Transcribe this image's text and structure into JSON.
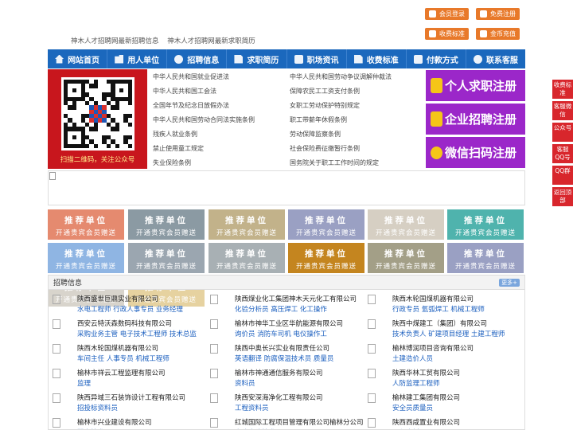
{
  "header": {
    "links": [
      "神木人才招聘网最新招聘信息",
      "神木人才招聘网最新求职简历"
    ],
    "buttons": [
      "会员登录",
      "免费注册",
      "收费标准",
      "金币充值"
    ]
  },
  "nav": {
    "items": [
      {
        "label": "网站首页",
        "icon": "home-icon"
      },
      {
        "label": "用人单位",
        "icon": "building-icon"
      },
      {
        "label": "招聘信息",
        "icon": "recruit-icon"
      },
      {
        "label": "求职简历",
        "icon": "resume-icon"
      },
      {
        "label": "职场资讯",
        "icon": "news-icon"
      },
      {
        "label": "收费标准",
        "icon": "fee-icon"
      },
      {
        "label": "付款方式",
        "icon": "payment-icon"
      },
      {
        "label": "联系客服",
        "icon": "service-icon"
      }
    ]
  },
  "qr": {
    "caption": "扫描二维码，关注公众号"
  },
  "laws": [
    "中华人民共和国就业促进法",
    "中华人民共和国劳动争议调解仲裁法",
    "中华人民共和国工会法",
    "保障农民工工资支付条例",
    "全国年节及纪念日放假办法",
    "女职工劳动保护特别规定",
    "中华人民共和国劳动合同法实施条例",
    "职工带薪年休假条例",
    "残疾人就业条例",
    "劳动保障监察条例",
    "禁止使用童工规定",
    "社会保险费征缴暂行条例",
    "失业保险条例",
    "国务院关于职工工作时间的规定"
  ],
  "register": [
    "个人求职注册",
    "企业招聘注册",
    "微信扫码注册"
  ],
  "side": [
    "收费标准",
    "客服微信",
    "公众号",
    "客服QQ号",
    "QQ群",
    "返回顶部"
  ],
  "recommend": {
    "title": "推荐单位",
    "subtitle": "开通贵宾会员赠送",
    "colors": [
      "#e58a6f",
      "#8b9aa3",
      "#c2b28a",
      "#9aa0c3",
      "#d6cfc3",
      "#4fb3ad",
      "#8fb5e3",
      "#9ba6b0",
      "#a8b0b4",
      "#c4851f",
      "#a39f87",
      "#9aa0c3",
      "#d8d4cc",
      "#e6d2a0"
    ]
  },
  "jobs": {
    "title": "招聘信息",
    "more": "更多+",
    "items": [
      {
        "company": "陕西盛世巨鼎实业有限公司",
        "positions": "水电工程师 行政人事专员 业务经理"
      },
      {
        "company": "陕西煤业化工集团神木天元化工有限公司",
        "positions": "化验分析员 高压焊工 化工操作"
      },
      {
        "company": "陕西木轮国煤机器有限公司",
        "positions": "行政专员 氩弧焊工 机械工程师"
      },
      {
        "company": "西安云特沃森数码科技有限公司",
        "positions": "采购业务主管 电子技术工程师 技术总监"
      },
      {
        "company": "榆林市神华工业区华航能源有限公司",
        "positions": "询价员 消防车司机 电仪操作工"
      },
      {
        "company": "陕西中煤建工（集团）有限公司",
        "positions": "技术负责人 矿建项目经理 土建工程师"
      },
      {
        "company": "陕西木轮国煤机器有限公司",
        "positions": "车间主任 人事专员 机械工程师"
      },
      {
        "company": "陕西中奥长兴实业有限责任公司",
        "positions": "英语翻译 防腐保温技术员 质量员"
      },
      {
        "company": "榆林博润项目咨询有限公司",
        "positions": "土建造价人员"
      },
      {
        "company": "榆林市祥云工程监理有限公司",
        "positions": "监理"
      },
      {
        "company": "榆林市神通通信服务有限公司",
        "positions": "资料员"
      },
      {
        "company": "陕西华林工贸有限公司",
        "positions": "人防监理工程师"
      },
      {
        "company": "陕西异域三石装饰设计工程有限公司",
        "positions": "招投标资料员"
      },
      {
        "company": "陕西安深海净化工程有限公司",
        "positions": "工程资料员"
      },
      {
        "company": "榆林建工集团有限公司",
        "positions": "安全员质量员"
      },
      {
        "company": "榆林市兴业建设有限公司",
        "positions": "弱电技术员"
      },
      {
        "company": "红城国际工程项目管理有限公司榆林分公司",
        "positions": "房建土建技术员"
      },
      {
        "company": "陕西西咸置业有限公司",
        "positions": "工程资料"
      }
    ]
  }
}
